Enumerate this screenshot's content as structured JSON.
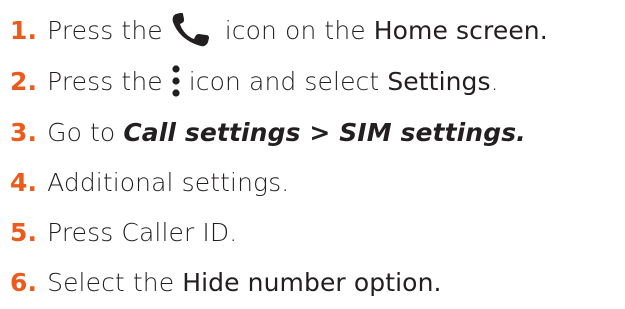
{
  "steps": [
    {
      "num": "1.",
      "pre": "Press the",
      "icon": "phone-icon",
      "mid": "icon on the",
      "bold": "Home screen."
    },
    {
      "num": "2.",
      "pre": "Press the",
      "icon": "more-vertical-icon",
      "mid": "icon and select",
      "bold": "Settings",
      "post": "."
    },
    {
      "num": "3.",
      "pre": "Go to",
      "italic": "Call settings > SIM settings."
    },
    {
      "num": "4.",
      "text": "Additional settings."
    },
    {
      "num": "5.",
      "text": "Press Caller ID."
    },
    {
      "num": "6.",
      "pre": "Select the",
      "bold": "Hide number option."
    }
  ],
  "colors": {
    "accent": "#ea5b1c",
    "text": "#231f20"
  }
}
